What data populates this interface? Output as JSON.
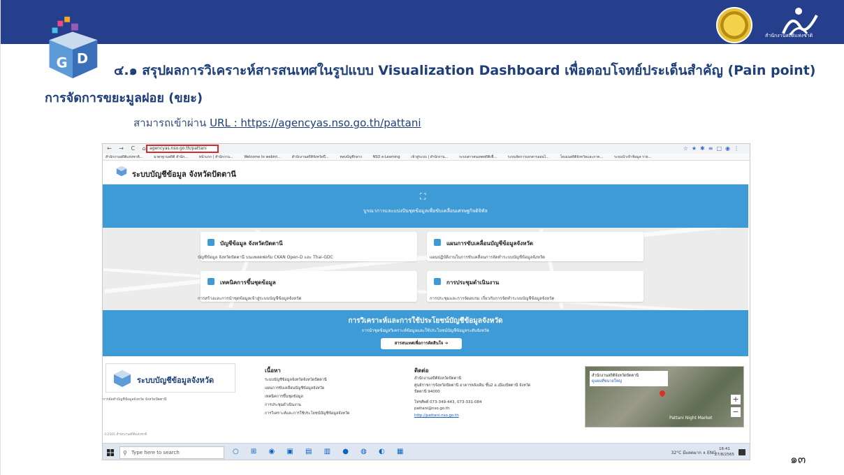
{
  "slide": {
    "title_line1": "๔.๑ สรุปผลการวิเคราะห์สารสนเทศในรูปแบบ Visualization Dashboard เพื่อตอบโจทย์ประเด็นสำคัญ (Pain point)",
    "title_line2": "การจัดการขยะมูลฝอย (ขยะ)",
    "access_prefix": "สามารถเข้าผ่าน ",
    "access_url": "URL : https://agencyas.nso.go.th/pattani",
    "nso_label": "สำนักงานสถิติแห่งชาติ",
    "page_number": "๑๓"
  },
  "browser": {
    "url": "agencyas.nso.go.th/pattani",
    "bookmarks": [
      "สำนักงานสถิติแห่งชาติ...",
      "มาตรฐานสถิติ สำนัก...",
      "หน้าแรก | สำนักงาน...",
      "Welcome to webint...",
      "สำนักงานสถิติจังหวัดปี...",
      "หลบบัญชีกลาง",
      "NSO e-Learning",
      "เข้าสู่ระบบ | สำนักงาน...",
      "ระบบสารสนเทศสถิติเพื่...",
      "ระบบจัดการเอกสารออนไ...",
      "โดเมนสถิติจังหวัดและภาค...",
      "ระบบนำเข้าข้อมูล ราย..."
    ]
  },
  "site": {
    "name": "ระบบบัญชีข้อมูล จังหวัดปัตตานี",
    "hero_text": "บูรณาการและแบ่งปันชุดข้อมูลเพื่อขับเคลื่อนเศรษฐกิจดิจิทัล",
    "cards": [
      {
        "title": "บัญชีข้อมูล จังหวัดปัตตานี",
        "desc": "บัญชีข้อมูล จังหวัดปัตตานี บนแพลตฟอร์ม CKAN Open-D และ Thai-GDC"
      },
      {
        "title": "แผนการขับเคลื่อนบัญชีข้อมูลจังหวัด",
        "desc": "แผนปฏิบัติงานในการขับเคลื่อนการจัดทำระบบบัญชีข้อมูลจังหวัด"
      },
      {
        "title": "เทคนิคการขึ้นชุดข้อมูล",
        "desc": "การสร้างและการนำชุดข้อมูลเข้าสู่ระบบบัญชีข้อมูลจังหวัด"
      },
      {
        "title": "การประชุมดำเนินงาน",
        "desc": "การประชุมและการจัดอบรม เกี่ยวกับการจัดทำระบบบัญชีข้อมูลจังหวัด"
      }
    ],
    "analysis_title": "การวิเคราะห์และการใช้ประโยชน์บัญชีข้อมูลจังหวัด",
    "analysis_sub": "การนำชุดข้อมูลวิเคราะห์ข้อมูลและใช้ประโยชน์บัญชีข้อมูลระดับจังหวัด",
    "analysis_button": "สารสนเทศเพื่อการตัดสินใจ ➔",
    "footer_logo_name": "ระบบบัญชีข้อมูลจังหวัด",
    "footer_small": "การจัดทำบัญชีข้อมูลจังหวัด จังหวัดปัตตานี",
    "content_title": "เนื้อหา",
    "content_links": [
      "ระบบบัญชีข้อมูลจังหวัดจังหวัดปัตตานี",
      "แผนการขับเคลื่อนบัญชีข้อมูลจังหวัด",
      "เทคนิคการขึ้นชุดข้อมูล",
      "การประชุมดำเนินงาน",
      "การวิเคราะห์และการใช้ประโยชน์บัญชีข้อมูลจังหวัด"
    ],
    "contact_title": "ติดต่อ",
    "contact_lines": [
      "สำนักงานสถิติจังหวัดปัตตานี",
      "ศูนย์ราชการจังหวัดปัตตานี อาคารหลังเดิม ชั้น2 อ.เมืองปัตตานี จังหวัด",
      "ปัตตานี 94000",
      "โทรศัพท์ 073-349-443, 073-331-084",
      "pattani@nso.go.th",
      "http://pattani.nso.go.th"
    ],
    "map_place": "สำนักงานสถิติจังหวัดปัตตานี",
    "map_link": "ดูแผนที่ขนาดใหญ่",
    "map_market": "Pattani Night Market",
    "copyright": "©2565 สำนักงานสถิติแห่งชาติ"
  },
  "taskbar": {
    "search_placeholder": "Type here to search",
    "tray": "32°C มีแดดมาก  ∧  ENG",
    "time": "16:41",
    "date": "27/8/2565"
  }
}
